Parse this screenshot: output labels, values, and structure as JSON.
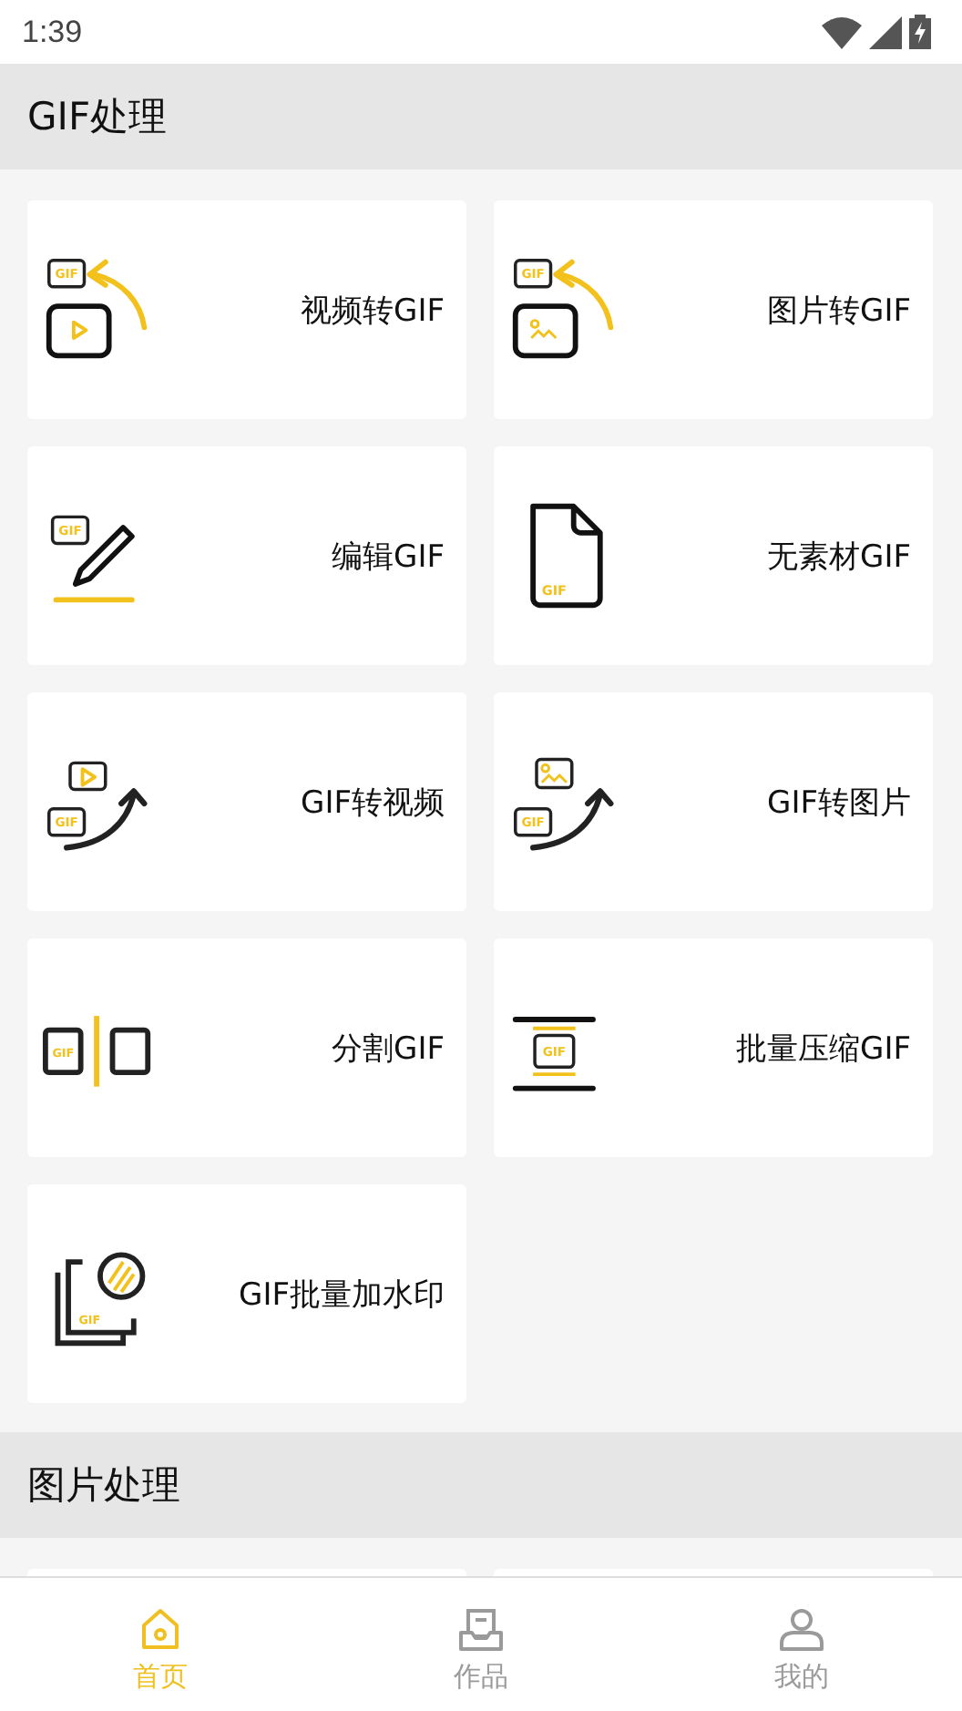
{
  "status_bar": {
    "time": "1:39"
  },
  "sections": [
    {
      "title": "GIF处理",
      "cards": [
        {
          "label": "视频转GIF",
          "kind": "video-to-gif",
          "icon_label": "GIF"
        },
        {
          "label": "图片转GIF",
          "kind": "image-to-gif",
          "icon_label": "GIF"
        },
        {
          "label": "编辑GIF",
          "kind": "edit",
          "icon_label": "GIF"
        },
        {
          "label": "无素材GIF",
          "kind": "blank",
          "icon_label": "GIF"
        },
        {
          "label": "GIF转视频",
          "kind": "gif-to-video",
          "icon_label": "GIF"
        },
        {
          "label": "GIF转图片",
          "kind": "gif-to-image",
          "icon_label": "GIF"
        },
        {
          "label": "分割GIF",
          "kind": "split",
          "icon_label": "GIF"
        },
        {
          "label": "批量压缩GIF",
          "kind": "compress",
          "icon_label": "GIF"
        },
        {
          "label": "GIF批量加水印",
          "kind": "watermark",
          "icon_label": "GIF"
        }
      ]
    },
    {
      "title": "图片处理",
      "cards": [
        {
          "kind": "hidden"
        },
        {
          "kind": "hidden"
        }
      ]
    }
  ],
  "bottom_nav": [
    {
      "label": "首页",
      "kind": "home",
      "selected": true
    },
    {
      "label": "作品",
      "kind": "works",
      "selected": false
    },
    {
      "label": "我的",
      "kind": "profile",
      "selected": false
    }
  ]
}
